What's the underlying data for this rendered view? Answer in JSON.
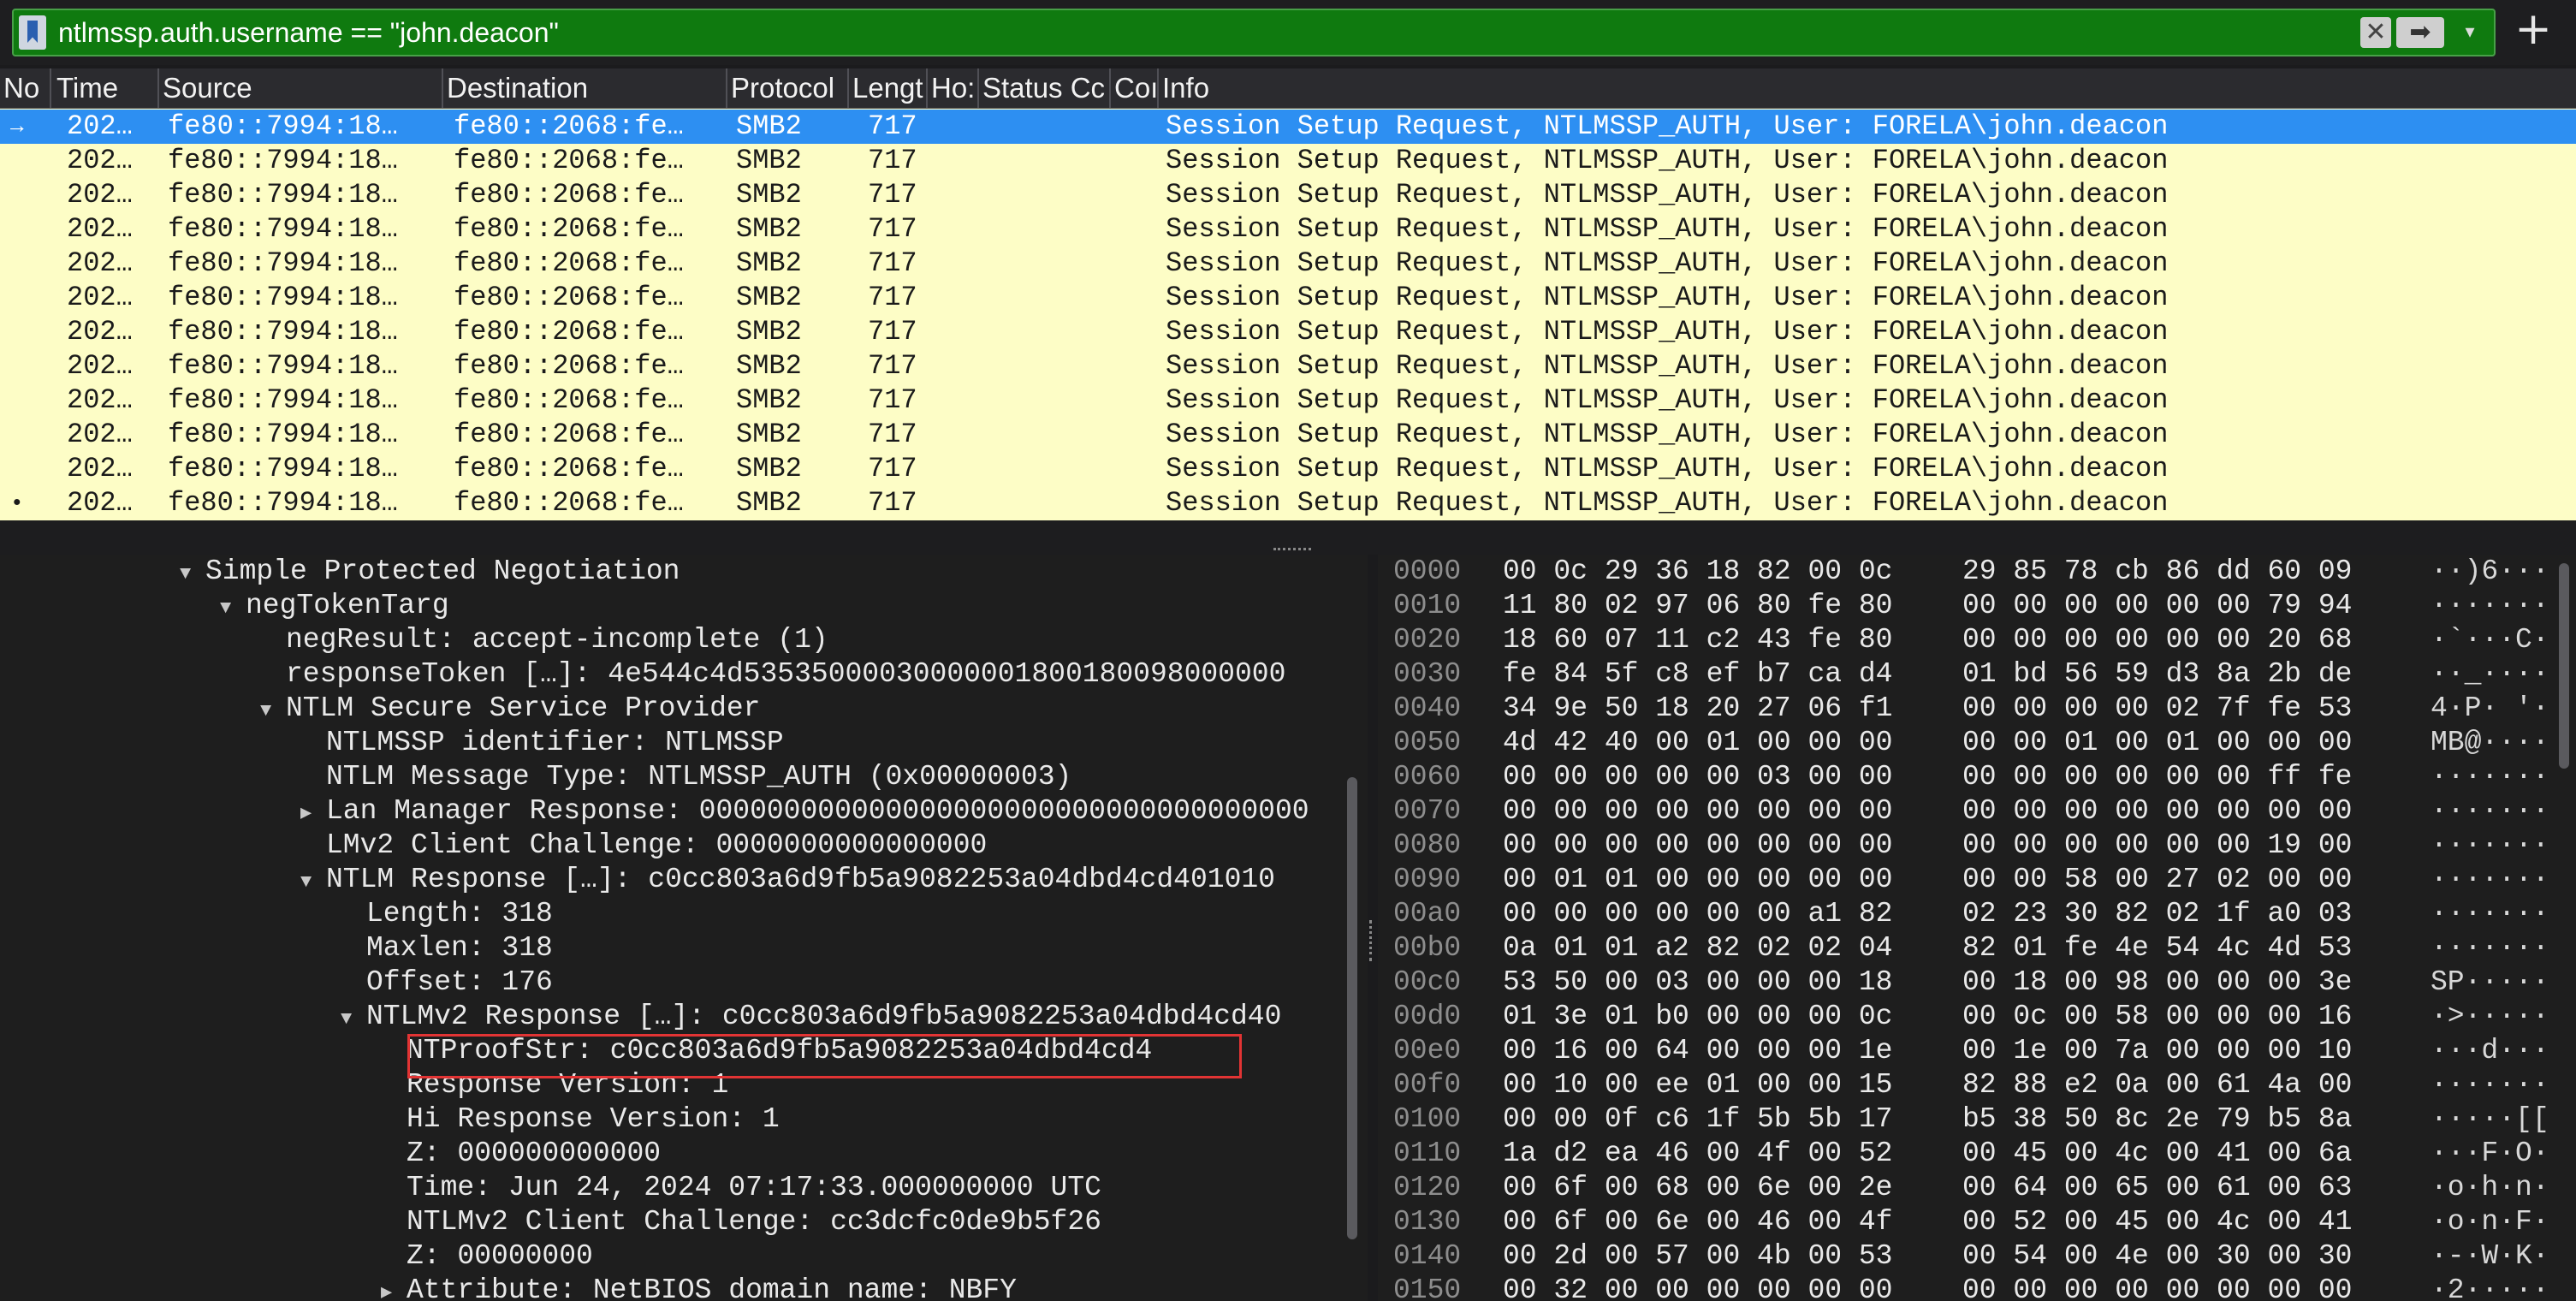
{
  "filter": {
    "expression": "ntlmssp.auth.username == \"john.deacon\""
  },
  "columns": [
    "No",
    "Time",
    "Source",
    "Destination",
    "Protocol",
    "Lengt",
    "Ho:",
    "Status Cc",
    "Coı",
    "Info"
  ],
  "packets": [
    {
      "time": "202…",
      "source": "fe80::7994:18…",
      "destination": "fe80::2068:fe…",
      "protocol": "SMB2",
      "length": "717",
      "info": "Session Setup Request, NTLMSSP_AUTH, User: FORELA\\john.deacon",
      "mark": "→"
    },
    {
      "time": "202…",
      "source": "fe80::7994:18…",
      "destination": "fe80::2068:fe…",
      "protocol": "SMB2",
      "length": "717",
      "info": "Session Setup Request, NTLMSSP_AUTH, User: FORELA\\john.deacon",
      "mark": ""
    },
    {
      "time": "202…",
      "source": "fe80::7994:18…",
      "destination": "fe80::2068:fe…",
      "protocol": "SMB2",
      "length": "717",
      "info": "Session Setup Request, NTLMSSP_AUTH, User: FORELA\\john.deacon",
      "mark": ""
    },
    {
      "time": "202…",
      "source": "fe80::7994:18…",
      "destination": "fe80::2068:fe…",
      "protocol": "SMB2",
      "length": "717",
      "info": "Session Setup Request, NTLMSSP_AUTH, User: FORELA\\john.deacon",
      "mark": ""
    },
    {
      "time": "202…",
      "source": "fe80::7994:18…",
      "destination": "fe80::2068:fe…",
      "protocol": "SMB2",
      "length": "717",
      "info": "Session Setup Request, NTLMSSP_AUTH, User: FORELA\\john.deacon",
      "mark": ""
    },
    {
      "time": "202…",
      "source": "fe80::7994:18…",
      "destination": "fe80::2068:fe…",
      "protocol": "SMB2",
      "length": "717",
      "info": "Session Setup Request, NTLMSSP_AUTH, User: FORELA\\john.deacon",
      "mark": ""
    },
    {
      "time": "202…",
      "source": "fe80::7994:18…",
      "destination": "fe80::2068:fe…",
      "protocol": "SMB2",
      "length": "717",
      "info": "Session Setup Request, NTLMSSP_AUTH, User: FORELA\\john.deacon",
      "mark": ""
    },
    {
      "time": "202…",
      "source": "fe80::7994:18…",
      "destination": "fe80::2068:fe…",
      "protocol": "SMB2",
      "length": "717",
      "info": "Session Setup Request, NTLMSSP_AUTH, User: FORELA\\john.deacon",
      "mark": ""
    },
    {
      "time": "202…",
      "source": "fe80::7994:18…",
      "destination": "fe80::2068:fe…",
      "protocol": "SMB2",
      "length": "717",
      "info": "Session Setup Request, NTLMSSP_AUTH, User: FORELA\\john.deacon",
      "mark": ""
    },
    {
      "time": "202…",
      "source": "fe80::7994:18…",
      "destination": "fe80::2068:fe…",
      "protocol": "SMB2",
      "length": "717",
      "info": "Session Setup Request, NTLMSSP_AUTH, User: FORELA\\john.deacon",
      "mark": ""
    },
    {
      "time": "202…",
      "source": "fe80::7994:18…",
      "destination": "fe80::2068:fe…",
      "protocol": "SMB2",
      "length": "717",
      "info": "Session Setup Request, NTLMSSP_AUTH, User: FORELA\\john.deacon",
      "mark": ""
    },
    {
      "time": "202…",
      "source": "fe80::7994:18…",
      "destination": "fe80::2068:fe…",
      "protocol": "SMB2",
      "length": "717",
      "info": "Session Setup Request, NTLMSSP_AUTH, User: FORELA\\john.deacon",
      "mark": "•"
    }
  ],
  "details": [
    {
      "level": 0,
      "toggle": "open",
      "text": "Simple Protected Negotiation"
    },
    {
      "level": 1,
      "toggle": "open",
      "text": "negTokenTarg"
    },
    {
      "level": 2,
      "toggle": "",
      "text": "negResult: accept-incomplete (1)"
    },
    {
      "level": 2,
      "toggle": "",
      "text": "responseToken […]: 4e544c4d53535000030000001800180098000000"
    },
    {
      "level": 2,
      "toggle": "open",
      "text": "NTLM Secure Service Provider"
    },
    {
      "level": 3,
      "toggle": "",
      "text": "NTLMSSP identifier: NTLMSSP"
    },
    {
      "level": 3,
      "toggle": "",
      "text": "NTLM Message Type: NTLMSSP_AUTH (0x00000003)"
    },
    {
      "level": 3,
      "toggle": "closed",
      "text": "Lan Manager Response: 000000000000000000000000000000000000"
    },
    {
      "level": 3,
      "toggle": "",
      "text": "LMv2 Client Challenge: 0000000000000000"
    },
    {
      "level": 3,
      "toggle": "open",
      "text": "NTLM Response […]: c0cc803a6d9fb5a9082253a04dbd4cd401010"
    },
    {
      "level": 4,
      "toggle": "",
      "text": "Length: 318"
    },
    {
      "level": 4,
      "toggle": "",
      "text": "Maxlen: 318"
    },
    {
      "level": 4,
      "toggle": "",
      "text": "Offset: 176"
    },
    {
      "level": 4,
      "toggle": "open",
      "text": "NTLMv2 Response […]: c0cc803a6d9fb5a9082253a04dbd4cd40"
    },
    {
      "level": 5,
      "toggle": "",
      "text": "NTProofStr: c0cc803a6d9fb5a9082253a04dbd4cd4"
    },
    {
      "level": 5,
      "toggle": "",
      "text": "Response Version: 1"
    },
    {
      "level": 5,
      "toggle": "",
      "text": "Hi Response Version: 1"
    },
    {
      "level": 5,
      "toggle": "",
      "text": "Z: 000000000000"
    },
    {
      "level": 5,
      "toggle": "",
      "text": "Time: Jun 24, 2024 07:17:33.000000000 UTC"
    },
    {
      "level": 5,
      "toggle": "",
      "text": "NTLMv2 Client Challenge: cc3dcfc0de9b5f26"
    },
    {
      "level": 5,
      "toggle": "",
      "text": "Z: 00000000"
    },
    {
      "level": 5,
      "toggle": "closed",
      "text": "Attribute: NetBIOS domain name: NBFY"
    }
  ],
  "bytes": [
    {
      "offset": "0000",
      "hex1": "00 0c 29 36 18 82 00 0c",
      "hex2": "29 85 78 cb 86 dd 60 09",
      "ascii": "··)6···"
    },
    {
      "offset": "0010",
      "hex1": "11 80 02 97 06 80 fe 80",
      "hex2": "00 00 00 00 00 00 79 94",
      "ascii": "·······"
    },
    {
      "offset": "0020",
      "hex1": "18 60 07 11 c2 43 fe 80",
      "hex2": "00 00 00 00 00 00 20 68",
      "ascii": "·`···C·"
    },
    {
      "offset": "0030",
      "hex1": "fe 84 5f c8 ef b7 ca d4",
      "hex2": "01 bd 56 59 d3 8a 2b de",
      "ascii": "··_····"
    },
    {
      "offset": "0040",
      "hex1": "34 9e 50 18 20 27 06 f1",
      "hex2": "00 00 00 00 02 7f fe 53",
      "ascii": "4·P· '·"
    },
    {
      "offset": "0050",
      "hex1": "4d 42 40 00 01 00 00 00",
      "hex2": "00 00 01 00 01 00 00 00",
      "ascii": "MB@····"
    },
    {
      "offset": "0060",
      "hex1": "00 00 00 00 00 03 00 00",
      "hex2": "00 00 00 00 00 00 ff fe",
      "ascii": "·······"
    },
    {
      "offset": "0070",
      "hex1": "00 00 00 00 00 00 00 00",
      "hex2": "00 00 00 00 00 00 00 00",
      "ascii": "·······"
    },
    {
      "offset": "0080",
      "hex1": "00 00 00 00 00 00 00 00",
      "hex2": "00 00 00 00 00 00 19 00",
      "ascii": "·······"
    },
    {
      "offset": "0090",
      "hex1": "00 01 01 00 00 00 00 00",
      "hex2": "00 00 58 00 27 02 00 00",
      "ascii": "·······"
    },
    {
      "offset": "00a0",
      "hex1": "00 00 00 00 00 00 a1 82",
      "hex2": "02 23 30 82 02 1f a0 03",
      "ascii": "·······"
    },
    {
      "offset": "00b0",
      "hex1": "0a 01 01 a2 82 02 02 04",
      "hex2": "82 01 fe 4e 54 4c 4d 53",
      "ascii": "·······"
    },
    {
      "offset": "00c0",
      "hex1": "53 50 00 03 00 00 00 18",
      "hex2": "00 18 00 98 00 00 00 3e",
      "ascii": "SP·····"
    },
    {
      "offset": "00d0",
      "hex1": "01 3e 01 b0 00 00 00 0c",
      "hex2": "00 0c 00 58 00 00 00 16",
      "ascii": "·>·····"
    },
    {
      "offset": "00e0",
      "hex1": "00 16 00 64 00 00 00 1e",
      "hex2": "00 1e 00 7a 00 00 00 10",
      "ascii": "···d···"
    },
    {
      "offset": "00f0",
      "hex1": "00 10 00 ee 01 00 00 15",
      "hex2": "82 88 e2 0a 00 61 4a 00",
      "ascii": "·······"
    },
    {
      "offset": "0100",
      "hex1": "00 00 0f c6 1f 5b 5b 17",
      "hex2": "b5 38 50 8c 2e 79 b5 8a",
      "ascii": "·····[["
    },
    {
      "offset": "0110",
      "hex1": "1a d2 ea 46 00 4f 00 52",
      "hex2": "00 45 00 4c 00 41 00 6a",
      "ascii": "···F·O·"
    },
    {
      "offset": "0120",
      "hex1": "00 6f 00 68 00 6e 00 2e",
      "hex2": "00 64 00 65 00 61 00 63",
      "ascii": "·o·h·n·"
    },
    {
      "offset": "0130",
      "hex1": "00 6f 00 6e 00 46 00 4f",
      "hex2": "00 52 00 45 00 4c 00 41",
      "ascii": "·o·n·F·"
    },
    {
      "offset": "0140",
      "hex1": "00 2d 00 57 00 4b 00 53",
      "hex2": "00 54 00 4e 00 30 00 30",
      "ascii": "·-·W·K·"
    },
    {
      "offset": "0150",
      "hex1": "00 32 00 00 00 00 00 00",
      "hex2": "00 00 00 00 00 00 00 00",
      "ascii": "·2·····"
    }
  ],
  "colors": {
    "filter_valid": "#0f7a0f",
    "list_background": "#fdfdc6",
    "selected_row": "#2d8ff2",
    "highlight_box": "#e23434"
  },
  "icons": [
    "bookmark-icon",
    "clear-icon",
    "apply-arrow-icon",
    "dropdown-icon",
    "add-icon"
  ]
}
